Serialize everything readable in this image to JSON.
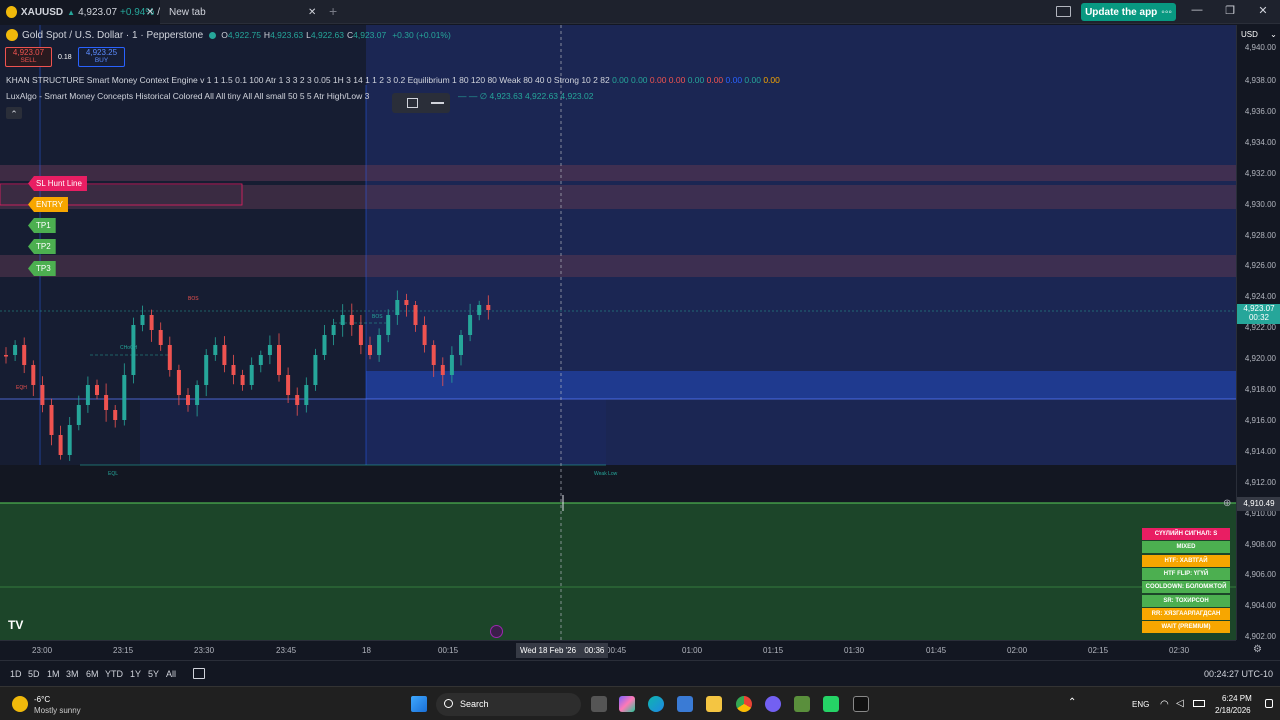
{
  "titlebar": {
    "tab1": {
      "symbol": "XAUUSD",
      "change_arrow": "▲",
      "price": "4,923.07",
      "change": "+0.94%",
      "sep": "/"
    },
    "tab2": {
      "label": "New tab"
    },
    "new_tab_glyph": "+",
    "close_glyph": "✕",
    "update_label": "Update the app",
    "update_dots": "◦◦◦",
    "minimize": "—",
    "maximize": "❐",
    "close": "✕"
  },
  "header": {
    "title": "Gold Spot / U.S. Dollar · 1 · Pepperstone",
    "ohlc": [
      {
        "k": "O",
        "v": "4,922.75"
      },
      {
        "k": "H",
        "v": "4,923.63"
      },
      {
        "k": "L",
        "v": "4,922.63"
      },
      {
        "k": "C",
        "v": "4,923.07"
      }
    ],
    "change": "+0.30 (+0.01%)",
    "sell_price": "4,923.07",
    "sell_label": "SELL",
    "spread": "0.18",
    "buy_price": "4,923.25",
    "buy_label": "BUY",
    "currency": "USD",
    "currency_caret": "⌄"
  },
  "indicators": {
    "line1_name": "KHAN STRUCTURE Smart Money Context Engine v 1 1 1.5 0.1 100 Atr 1 3 3 2 3 0.05 1H 3 14 1 1 2 3 0.2 Equilibrium 1 80 120 80 Weak 80 40 0 Strong 10 2 82",
    "line1_values": [
      {
        "v": "0.00",
        "c": "#26a69a"
      },
      {
        "v": "0.00",
        "c": "#26a69a"
      },
      {
        "v": "0.00",
        "c": "#ef5350"
      },
      {
        "v": "0.00",
        "c": "#ef5350"
      },
      {
        "v": "0.00",
        "c": "#26a69a"
      },
      {
        "v": "0.00",
        "c": "#ef5350"
      },
      {
        "v": "0.00",
        "c": "#2962ff"
      },
      {
        "v": "0.00",
        "c": "#26a69a"
      },
      {
        "v": "0.00",
        "c": "#f7a600"
      }
    ],
    "line2_name": "LuxAlgo - Smart Money Concepts Historical Colored All All tiny All All small 50 5 5 Atr High/Low 3",
    "line2_values": "— — ∅ 4,923.63  4,922.63  4,923.02",
    "collapse_glyph": "⌃"
  },
  "zones": {
    "sl": "SL Hunt Line",
    "entry": "ENTRY",
    "tp1": "TP1",
    "tp2": "TP2",
    "tp3": "TP3"
  },
  "price_axis": {
    "labels": [
      "4,938.00",
      "4,936.00",
      "4,934.00",
      "4,932.00",
      "4,930.00",
      "4,928.00",
      "4,926.00",
      "4,924.00",
      "4,922.00",
      "4,920.00",
      "4,918.00",
      "4,916.00",
      "4,914.00",
      "4,912.00",
      "4,910.00",
      "4,908.00",
      "4,906.00",
      "4,904.00",
      "4,902.00"
    ],
    "top_partial": "4,940.00",
    "current_price": "4,923.07",
    "countdown": "00:32",
    "crosshair_price": "4,910.49",
    "crosshair_icon": "⊕"
  },
  "time_axis": {
    "labels": [
      "23:00",
      "23:15",
      "23:30",
      "23:45",
      "18",
      "00:15",
      "00:45",
      "01:00",
      "01:15",
      "01:30",
      "01:45",
      "02:00",
      "02:15",
      "02:30"
    ],
    "crosshair_date": "Wed 18 Feb '26",
    "crosshair_time": "00:36",
    "settings_glyph": "⚙"
  },
  "signals": [
    {
      "label": "СҮҮЛИЙН СИГНАЛ: S",
      "color": "#e91e63"
    },
    {
      "label": "MIXED",
      "color": "#4caf50"
    },
    {
      "label": "HTF: ХАВТГАЙ",
      "color": "#f7a600"
    },
    {
      "label": "HTF FLIP: ҮГҮЙ",
      "color": "#4caf50"
    },
    {
      "label": "COOLDOWN: БОЛОМЖТОЙ",
      "color": "#4caf50"
    },
    {
      "label": "SR: ТОХИРСОН",
      "color": "#4caf50"
    },
    {
      "label": "RR: ХЯЗГААРЛАГДСАН",
      "color": "#f7a600"
    },
    {
      "label": "WAIT (PREMIUM)",
      "color": "#f7a600"
    }
  ],
  "chart_labels": {
    "small1": "CHoCH",
    "small2": "BOS",
    "small3": "EQL",
    "small4": "Weak Low",
    "small5": "EQH",
    "small6": "BOS",
    "logo": "TV"
  },
  "bottom": {
    "ranges": [
      "1D",
      "5D",
      "1M",
      "3M",
      "6M",
      "YTD",
      "1Y",
      "5Y",
      "All"
    ],
    "calendar_glyph": "📅",
    "clock": "00:24:27 UTC-10"
  },
  "taskbar": {
    "temp": "-6°C",
    "weather": "Mostly sunny",
    "search": "Search",
    "lang": "ENG",
    "time": "6:24 PM",
    "date": "2/18/2026"
  }
}
